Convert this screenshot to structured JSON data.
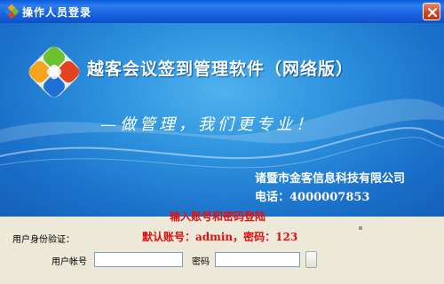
{
  "window": {
    "title": "操作人员登录",
    "close_symbol": "×"
  },
  "banner": {
    "app_title": "越客会议签到管理软件（网络版）",
    "slogan": "—做管理，我们更专业！",
    "company": "诸暨市金客信息科技有限公司",
    "phone": "电话：4000007853"
  },
  "form": {
    "hint_line1": "输入账号和密码登陆",
    "hint_line2": "默认账号：admin，密码：123",
    "verify_label": "用户身份验证：",
    "user_label": "用户帐号",
    "user_value": "",
    "password_label": "密码",
    "password_value": "",
    "login_button_label": ""
  },
  "colors": {
    "titlebar": "#0a5bd8",
    "banner": "#2b8fdc",
    "panel": "#ece9d8",
    "hint": "#e01010"
  },
  "icons": [
    "app-icon",
    "close-icon",
    "logo-icon"
  ]
}
